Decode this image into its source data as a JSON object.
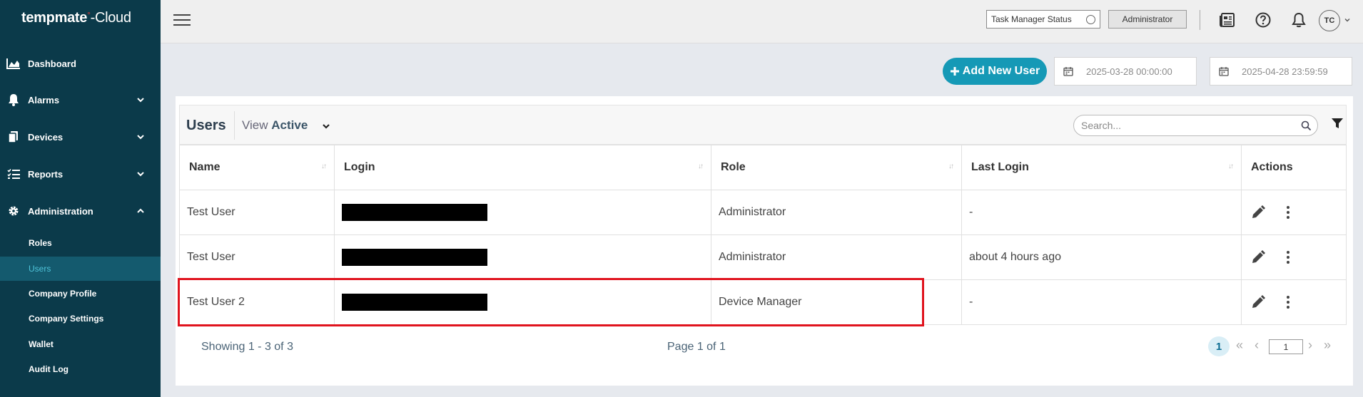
{
  "app": {
    "logo_brand": "tempmate",
    "logo_dot": "°",
    "logo_suffix": "-Cloud"
  },
  "sidebar": {
    "items": [
      {
        "label": "Dashboard",
        "icon": "area-chart-icon"
      },
      {
        "label": "Alarms",
        "icon": "bell-icon",
        "expandable": true
      },
      {
        "label": "Devices",
        "icon": "devices-icon",
        "expandable": true
      },
      {
        "label": "Reports",
        "icon": "list-icon",
        "expandable": true
      },
      {
        "label": "Administration",
        "icon": "gear-icon",
        "expanded": true
      }
    ],
    "subitems": [
      {
        "label": "Roles"
      },
      {
        "label": "Users",
        "active": true
      },
      {
        "label": "Company Profile"
      },
      {
        "label": "Company Settings"
      },
      {
        "label": "Wallet"
      },
      {
        "label": "Audit Log"
      }
    ]
  },
  "topbar": {
    "task_manager_status": "Task Manager Status",
    "role_button": "Administrator",
    "avatar_initials": "TC"
  },
  "toolbar": {
    "add_user_label": "Add New User",
    "date_from": "2025-03-28 00:00:00",
    "date_to": "2025-04-28 23:59:59"
  },
  "panel": {
    "title": "Users",
    "view_prefix": "View",
    "view_value": "Active",
    "search_placeholder": "Search..."
  },
  "table": {
    "headers": [
      "Name",
      "Login",
      "Role",
      "Last Login",
      "Actions"
    ],
    "rows": [
      {
        "name": "Test User",
        "role": "Administrator",
        "last_login": "-"
      },
      {
        "name": "Test User",
        "role": "Administrator",
        "last_login": "about 4 hours ago"
      },
      {
        "name": "Test User 2",
        "role": "Device Manager",
        "last_login": "-"
      }
    ]
  },
  "footer": {
    "showing": "Showing 1 - 3 of 3",
    "page_info": "Page 1 of 1",
    "current_page": "1",
    "page_input": "1"
  },
  "colors": {
    "sidebar_bg": "#0b3a4a",
    "accent": "#1599b6",
    "highlight": "#e0141e"
  }
}
